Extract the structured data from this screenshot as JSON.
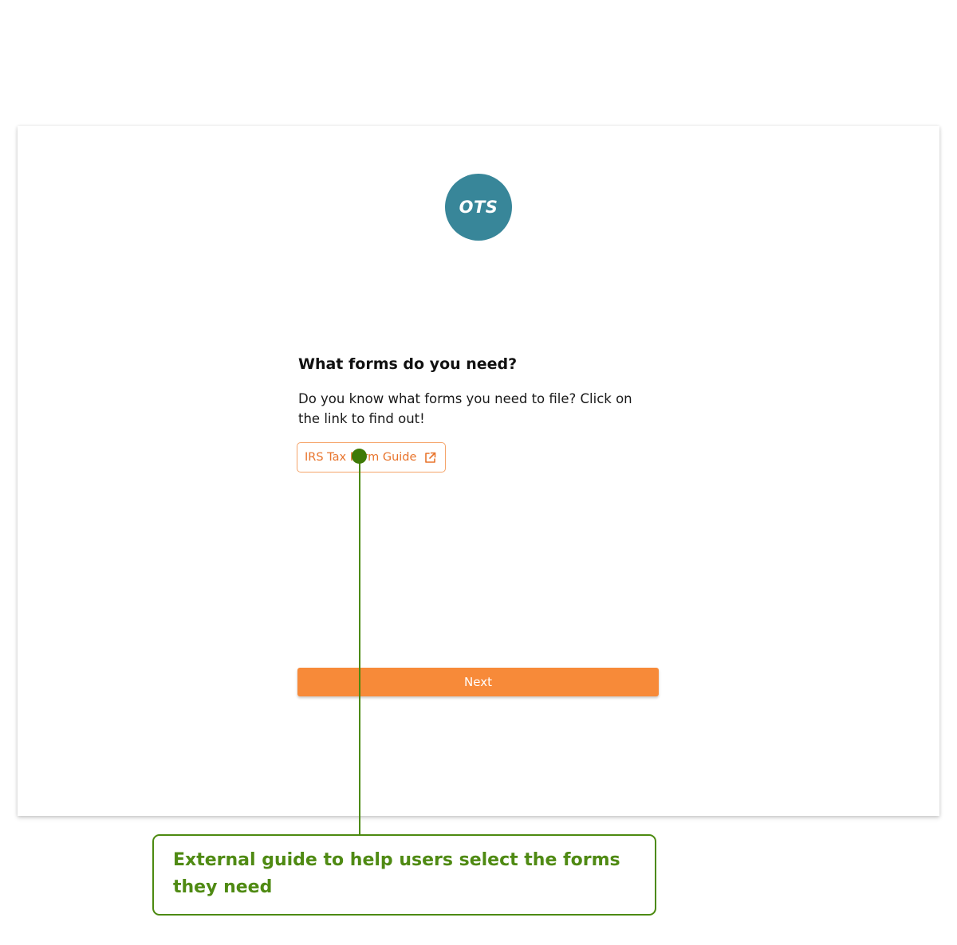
{
  "logo": {
    "text": "OTS",
    "color": "#388699"
  },
  "page": {
    "title": "What forms do you need?",
    "description": "Do you know what forms you need to file? Click on the link to find out!",
    "guide_link": {
      "label": "IRS Tax Form Guide",
      "icon": "external-link-icon",
      "color": "#e8742c"
    },
    "next_button": {
      "label": "Next",
      "color": "#f78a39"
    }
  },
  "annotation": {
    "text": "External guide to help users select the forms they need",
    "color": "#4f8a13"
  }
}
